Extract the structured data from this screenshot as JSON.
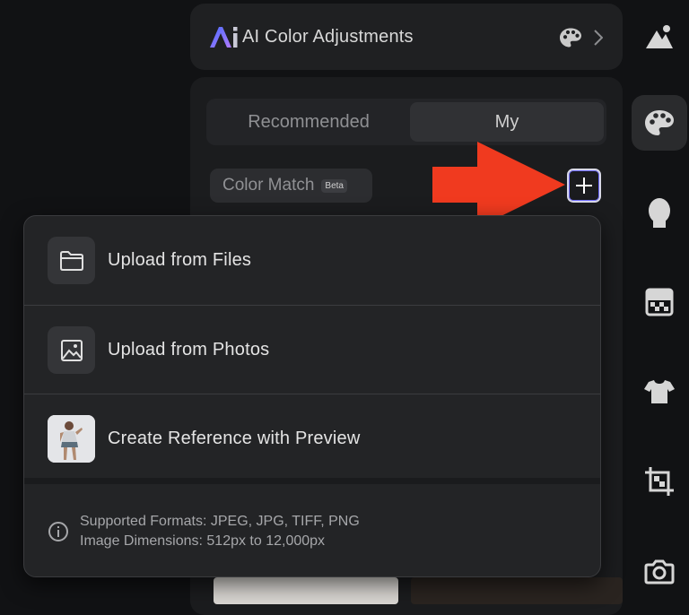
{
  "header": {
    "title": "AI Color Adjustments",
    "logo_text": "Ai"
  },
  "tabs": [
    {
      "label": "Recommended",
      "active": false
    },
    {
      "label": "My",
      "active": true
    }
  ],
  "color_match": {
    "label": "Color Match",
    "badge": "Beta"
  },
  "dropdown": {
    "items": [
      {
        "label": "Upload from Files",
        "icon": "folder-icon"
      },
      {
        "label": "Upload from Photos",
        "icon": "image-icon"
      },
      {
        "label": "Create Reference with Preview",
        "icon": "preview-photo-thumbnail"
      }
    ],
    "info_line1": "Supported Formats: JPEG, JPG, TIFF, PNG",
    "info_line2": "Image Dimensions: 512px to 12,000px"
  },
  "rail": {
    "icons": [
      "landscape-icon",
      "palette-icon",
      "face-icon",
      "texture-icon",
      "shirt-icon",
      "crop-icon",
      "camera-icon"
    ],
    "active": "palette-icon"
  },
  "colors": {
    "arrow": "#f03a1f",
    "accent_blue": "#6f6cff"
  }
}
